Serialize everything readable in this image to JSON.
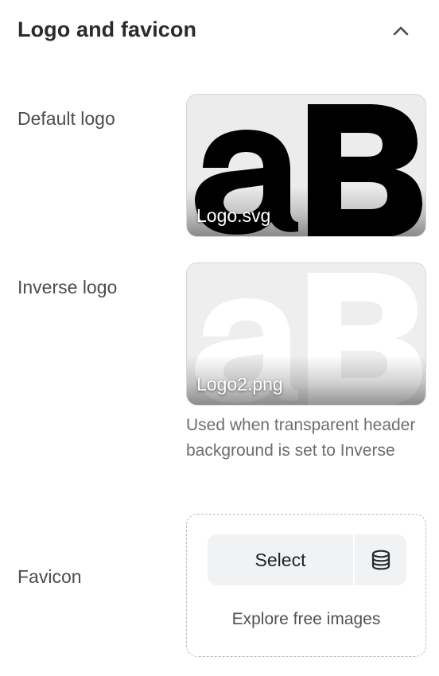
{
  "section": {
    "title": "Logo and favicon",
    "collapse_icon": "chevron-up-icon"
  },
  "default_logo": {
    "label": "Default logo",
    "filename": "Logo.svg"
  },
  "inverse_logo": {
    "label": "Inverse logo",
    "filename": "Logo2.png",
    "help_text": "Used when transparent header background is set to Inverse"
  },
  "favicon": {
    "label": "Favicon",
    "select_label": "Select",
    "library_icon": "database-icon",
    "explore_label": "Explore free images"
  }
}
